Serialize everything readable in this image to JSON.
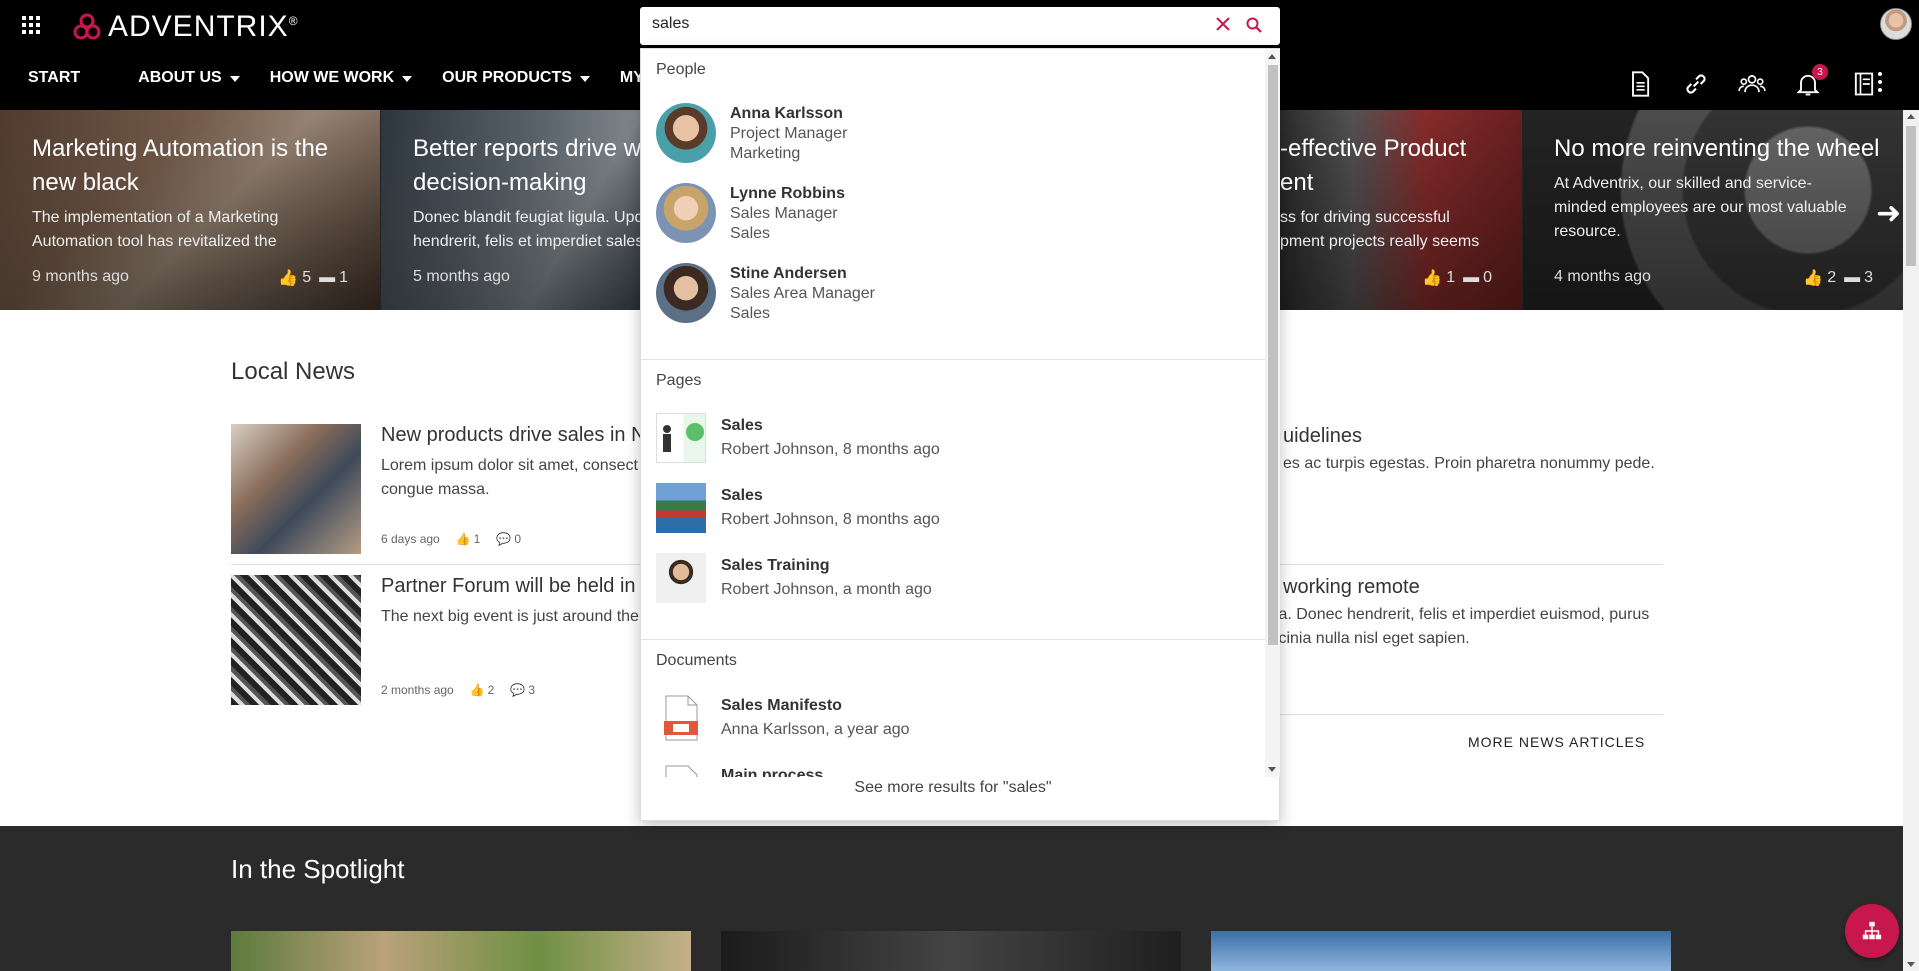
{
  "app": {
    "brand": "ADVENTRIX",
    "brand_mark": "®"
  },
  "nav": {
    "items": [
      {
        "label": "START"
      },
      {
        "label": "ABOUT US"
      },
      {
        "label": "HOW WE WORK"
      },
      {
        "label": "OUR PRODUCTS"
      },
      {
        "label": "MY EMPL"
      }
    ]
  },
  "toolbar": {
    "notifications_count": "3"
  },
  "hero": {
    "cards": [
      {
        "title": "Marketing Automation is the new black",
        "excerpt": "The implementation of a Marketing Automation tool has revitalized the",
        "age": "9 months ago",
        "likes": "5",
        "comments": "1"
      },
      {
        "title": "Better reports drive wis decision-making",
        "excerpt": "Donec blandit feugiat ligula. Upd hendrerit, felis et imperdiet sales",
        "age": "5 months ago"
      },
      {
        "title": "-effective Product ent",
        "excerpt": "ss for driving successful pment projects really seems",
        "likes": "1",
        "comments": "0"
      },
      {
        "title": "No more reinventing the wheel",
        "excerpt": "At Adventrix, our skilled and service-minded employees are our most valuable resource.",
        "age": "4 months ago",
        "likes": "2",
        "comments": "3"
      }
    ]
  },
  "local_news": {
    "heading": "Local News",
    "items": [
      {
        "title": "New products drive sales in N",
        "excerpt": "Lorem ipsum dolor sit amet, consect congue massa.",
        "age": "6 days ago",
        "likes": "1",
        "comments": "0"
      },
      {
        "title": "Partner Forum will be held in",
        "excerpt": "The next big event is just around the",
        "age": "2 months ago",
        "likes": "2",
        "comments": "3"
      }
    ],
    "right_items": [
      {
        "title": "uidelines",
        "excerpt": "es ac turpis egestas. Proin pharetra nonummy pede."
      },
      {
        "title": "working remote",
        "excerpt": "ula. Donec hendrerit, felis et imperdiet euismod, purus lacinia nulla nisl eget sapien."
      }
    ],
    "more_label": "MORE NEWS ARTICLES"
  },
  "spotlight": {
    "heading": "In the Spotlight"
  },
  "search": {
    "query": "sales",
    "people_heading": "People",
    "people": [
      {
        "name": "Anna Karlsson",
        "role": "Project Manager",
        "dept": "Marketing"
      },
      {
        "name": "Lynne Robbins",
        "role": "Sales Manager",
        "dept": "Sales"
      },
      {
        "name": "Stine Andersen",
        "role": "Sales Area Manager",
        "dept": "Sales"
      }
    ],
    "pages_heading": "Pages",
    "pages": [
      {
        "title": "Sales",
        "sub": "Robert Johnson, 8 months ago"
      },
      {
        "title": "Sales",
        "sub": "Robert Johnson, 8 months ago"
      },
      {
        "title": "Sales Training",
        "sub": "Robert Johnson, a month ago"
      }
    ],
    "documents_heading": "Documents",
    "documents": [
      {
        "title": "Sales Manifesto",
        "sub": "Anna Karlsson, a year ago"
      },
      {
        "title": "Main process",
        "sub": ""
      }
    ],
    "see_more": "See more results for \"sales\""
  },
  "colors": {
    "accent": "#c8174e",
    "topbar": "#000000",
    "spotlight": "#2b2b2b"
  }
}
